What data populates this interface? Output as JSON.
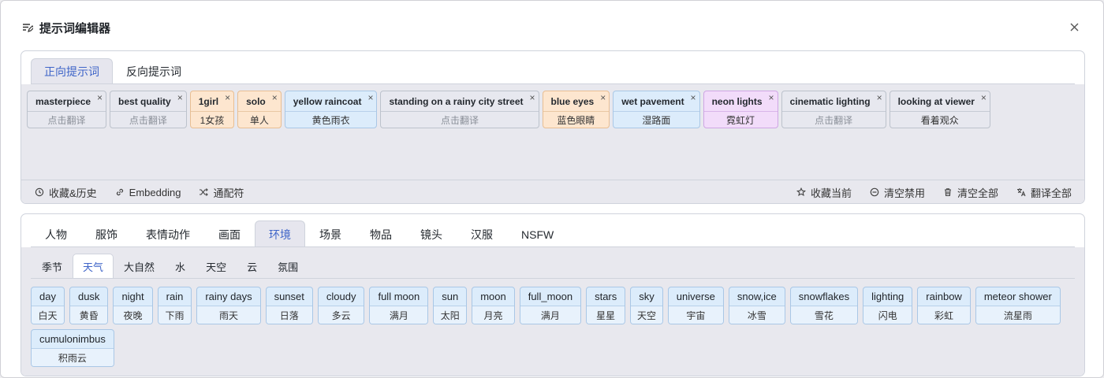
{
  "dialog": {
    "title": "提示词编辑器"
  },
  "prompt_tabs": [
    "正向提示词",
    "反向提示词"
  ],
  "tags": [
    {
      "en": "masterpiece",
      "zh": "点击翻译",
      "muted": true,
      "color": "gray"
    },
    {
      "en": "best quality",
      "zh": "点击翻译",
      "muted": true,
      "color": "gray"
    },
    {
      "en": "1girl",
      "zh": "1女孩",
      "muted": false,
      "color": "orange"
    },
    {
      "en": "solo",
      "zh": "单人",
      "muted": false,
      "color": "orange"
    },
    {
      "en": "yellow raincoat",
      "zh": "黄色雨衣",
      "muted": false,
      "color": "blue"
    },
    {
      "en": "standing on a rainy city street",
      "zh": "点击翻译",
      "muted": true,
      "color": "gray"
    },
    {
      "en": "blue eyes",
      "zh": "蓝色眼睛",
      "muted": false,
      "color": "orange"
    },
    {
      "en": "wet pavement",
      "zh": "湿路面",
      "muted": false,
      "color": "blue"
    },
    {
      "en": "neon lights",
      "zh": "霓虹灯",
      "muted": false,
      "color": "purple"
    },
    {
      "en": "cinematic lighting",
      "zh": "点击翻译",
      "muted": true,
      "color": "gray"
    },
    {
      "en": "looking at viewer",
      "zh": "看着观众",
      "muted": false,
      "color": "gray"
    }
  ],
  "tag_close_glyph": "×",
  "toolbar": {
    "left": [
      {
        "label": "收藏&历史",
        "icon": "history-icon"
      },
      {
        "label": "Embedding",
        "icon": "link-icon"
      },
      {
        "label": "通配符",
        "icon": "shuffle-icon"
      }
    ],
    "right": [
      {
        "label": "收藏当前",
        "icon": "star-icon"
      },
      {
        "label": "清空禁用",
        "icon": "minus-circle-icon"
      },
      {
        "label": "清空全部",
        "icon": "trash-icon"
      },
      {
        "label": "翻译全部",
        "icon": "translate-icon"
      }
    ]
  },
  "categories": [
    "人物",
    "服饰",
    "表情动作",
    "画面",
    "环境",
    "场景",
    "物品",
    "镜头",
    "汉服",
    "NSFW"
  ],
  "active_category": 4,
  "subcategories": [
    "季节",
    "天气",
    "大自然",
    "水",
    "天空",
    "云",
    "氛围"
  ],
  "active_subcategory": 1,
  "words": [
    {
      "en": "day",
      "zh": "白天"
    },
    {
      "en": "dusk",
      "zh": "黄昏"
    },
    {
      "en": "night",
      "zh": "夜晚"
    },
    {
      "en": "rain",
      "zh": "下雨"
    },
    {
      "en": "rainy days",
      "zh": "雨天"
    },
    {
      "en": "sunset",
      "zh": "日落"
    },
    {
      "en": "cloudy",
      "zh": "多云"
    },
    {
      "en": "full moon",
      "zh": "满月"
    },
    {
      "en": "sun",
      "zh": "太阳"
    },
    {
      "en": "moon",
      "zh": "月亮"
    },
    {
      "en": "full_moon",
      "zh": "满月"
    },
    {
      "en": "stars",
      "zh": "星星"
    },
    {
      "en": "sky",
      "zh": "天空"
    },
    {
      "en": "universe",
      "zh": "宇宙"
    },
    {
      "en": "snow,ice",
      "zh": "冰雪"
    },
    {
      "en": "snowflakes",
      "zh": "雪花"
    },
    {
      "en": "lighting",
      "zh": "闪电"
    },
    {
      "en": "rainbow",
      "zh": "彩虹"
    },
    {
      "en": "meteor shower",
      "zh": "流星雨"
    },
    {
      "en": "cumulonimbus",
      "zh": "积雨云"
    }
  ],
  "colors": {
    "accent": "#3e64c8",
    "panel_bg": "#e8e8ee",
    "word_bg": "#dcecfb",
    "tag_orange": "#fde6cf",
    "tag_blue": "#dcecfb",
    "tag_purple": "#f2dcfa"
  }
}
